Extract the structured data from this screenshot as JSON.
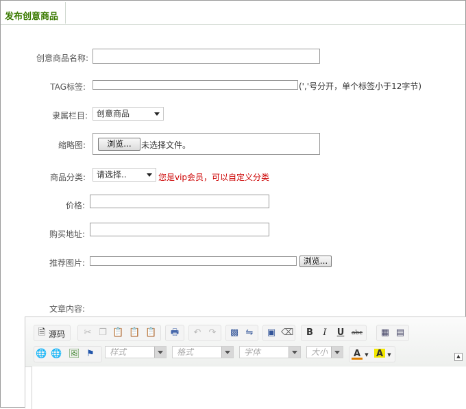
{
  "tab": {
    "label": "发布创意商品"
  },
  "form": {
    "name_label": "创意商品名称:",
    "tag_label": "TAG标签:",
    "tag_hint": "(','号分开，单个标签小于12字节)",
    "column_label": "隶属栏目:",
    "column_selected": "创意商品",
    "thumb_label": "缩略图:",
    "thumb_browse": "浏览...",
    "thumb_status": "未选择文件。",
    "category_label": "商品分类:",
    "category_selected": "请选择..",
    "category_hint": "您是vip会员，可以自定义分类",
    "price_label": "价格:",
    "buy_url_label": "购买地址:",
    "rec_image_label": "推荐图片:",
    "rec_browse": "浏览...",
    "content_label": "文章内容:"
  },
  "editor": {
    "source_label": "源码",
    "style_placeholder": "样式",
    "format_placeholder": "格式",
    "font_placeholder": "字体",
    "size_placeholder": "大小",
    "bold": "B",
    "italic": "I",
    "underline": "U",
    "strike": "abc",
    "font_color": "A",
    "bg_color": "A"
  }
}
